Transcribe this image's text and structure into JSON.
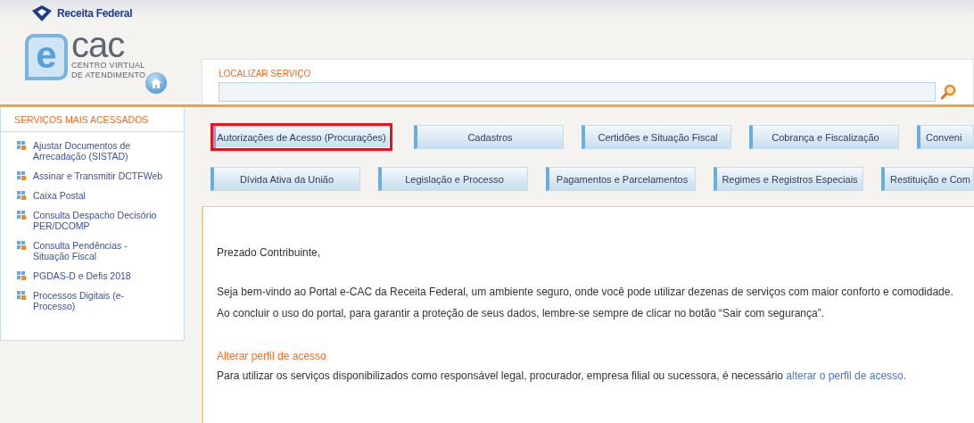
{
  "header": {
    "brand": "Receita Federal",
    "logo_letter": "e",
    "logo_word": "cac",
    "logo_line_1": "CENTRO VIRTUAL",
    "logo_line_2": "DE ATENDIMENTO"
  },
  "search": {
    "label": "LOCALIZAR SERVIÇO"
  },
  "sidebar": {
    "title": "SERVIÇOS MAIS ACESSADOS",
    "items": [
      {
        "label": "Ajustar Documentos de Arrecadação (SISTAD)"
      },
      {
        "label": "Assinar e Transmitir DCTFWeb"
      },
      {
        "label": "Caixa Postal"
      },
      {
        "label": "Consulta Despacho Decisório PER/DCOMP"
      },
      {
        "label": "Consulta Pendências - Situação Fiscal"
      },
      {
        "label": "PGDAS-D e Defis 2018"
      },
      {
        "label": "Processos Digitais (e-Processo)"
      }
    ]
  },
  "categories": [
    [
      {
        "label": "Autorizações de Acesso (Procurações)",
        "selected": true
      },
      {
        "label": "Cadastros",
        "selected": false
      },
      {
        "label": "Certidões e Situação Fiscal",
        "selected": false
      },
      {
        "label": "Cobrança e Fiscalização",
        "selected": false
      },
      {
        "label": "Conveni",
        "selected": false
      }
    ],
    [
      {
        "label": "Dívida Ativa da União",
        "selected": false
      },
      {
        "label": "Legislação e Processo",
        "selected": false
      },
      {
        "label": "Pagamentos e Parcelamentos",
        "selected": false
      },
      {
        "label": "Regimes e Registros Especiais",
        "selected": false
      },
      {
        "label": "Restituição e Com",
        "selected": false
      }
    ]
  ],
  "content": {
    "greeting": "Prezado Contribuinte,",
    "paragraphs": [
      "Seja bem-vindo ao Portal e-CAC da Receita Federal, um ambiente seguro, onde você pode utilizar dezenas de serviços com maior conforto e comodidade.",
      "Ao concluir o uso do portal, para garantir a proteção de seus dados, lembre-se sempre de clicar no botão “Sair com segurança”."
    ],
    "section_title": "Alterar perfil de acesso",
    "section_text": "Para utilizar os serviços disponibilizados como responsável legal, procurador, empresa filial ou sucessora, é necessário",
    "section_link": "alterar o perfil de acesso."
  }
}
